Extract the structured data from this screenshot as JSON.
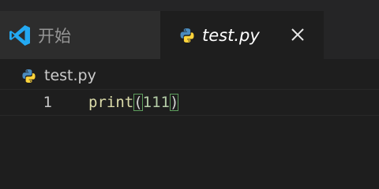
{
  "tabs": {
    "welcome": {
      "label": "开始",
      "icon": "vscode-logo-icon"
    },
    "file": {
      "label": "test.py",
      "icon": "python-icon",
      "active": true,
      "close_icon": "close-icon"
    }
  },
  "breadcrumb": {
    "file_label": "test.py",
    "icon": "python-icon"
  },
  "editor": {
    "lines": [
      {
        "number": "1",
        "tokens": {
          "function": "print",
          "open_paren": "(",
          "argument": "111",
          "close_paren": ")"
        }
      }
    ]
  },
  "colors": {
    "background": "#1e1e1e",
    "tabbar": "#252526",
    "inactive_tab": "#2d2d2d",
    "function": "#dcdcaa",
    "number": "#b5cea8",
    "bracket_match": "#5e9e5e",
    "vscode_blue": "#23a9f2",
    "python_blue": "#4b8bbe",
    "python_yellow": "#ffd43b"
  }
}
